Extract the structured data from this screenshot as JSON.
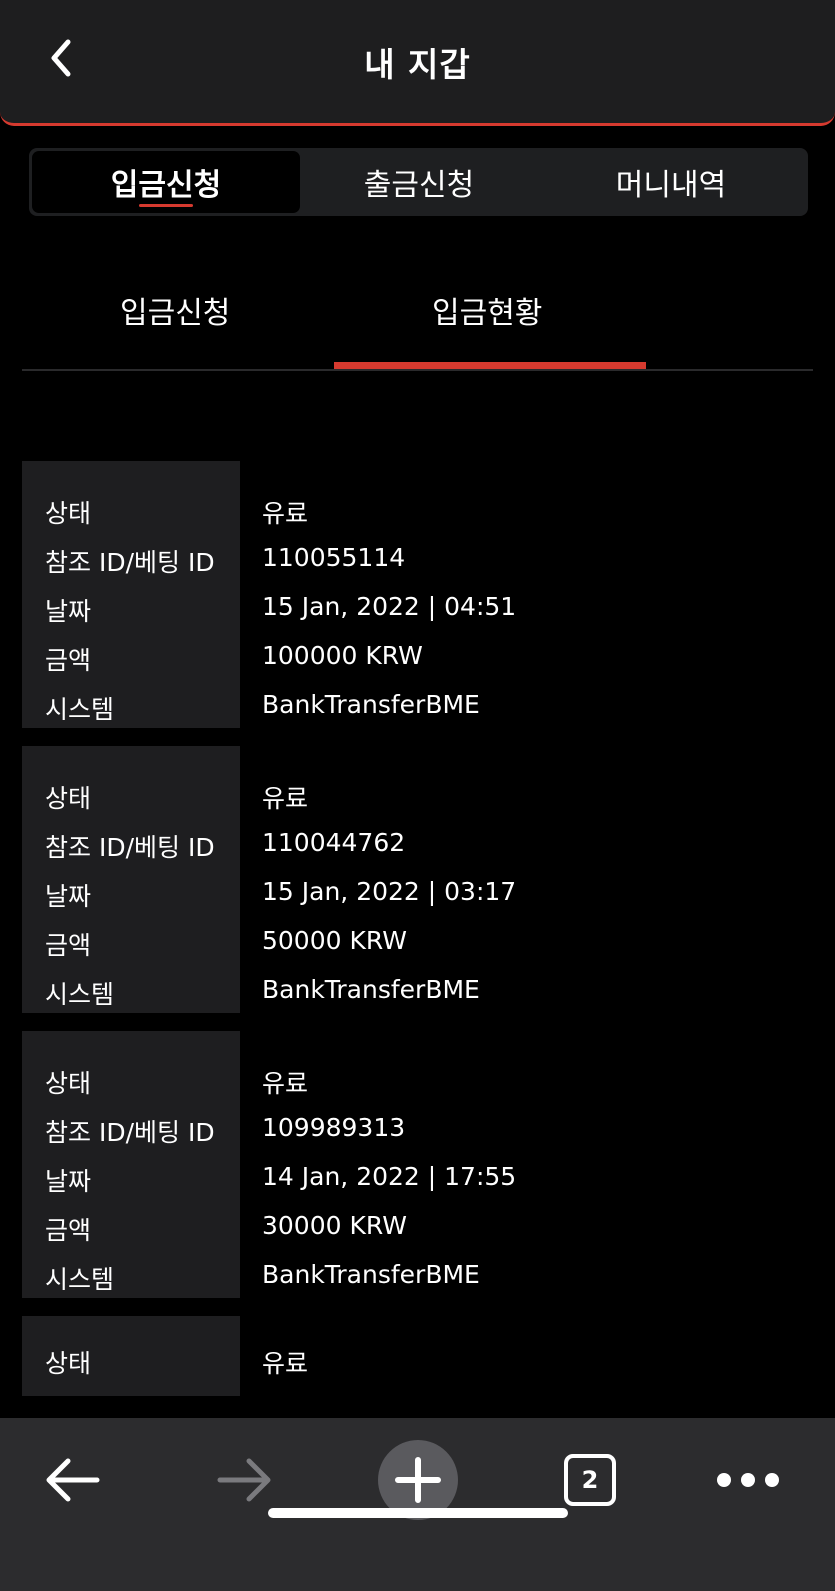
{
  "header": {
    "title": "내 지갑",
    "back_icon": "chevron-left-icon"
  },
  "segments": [
    {
      "label": "입금신청",
      "active": true
    },
    {
      "label": "출금신청",
      "active": false
    },
    {
      "label": "머니내역",
      "active": false
    }
  ],
  "subtabs": [
    {
      "label": "입금신청",
      "active": false
    },
    {
      "label": "입금현황",
      "active": true
    }
  ],
  "field_labels": {
    "status": "상태",
    "ref_id": "참조 ID/베팅 ID",
    "date": "날짜",
    "amount": "금액",
    "system": "시스템"
  },
  "records": [
    {
      "status": "유료",
      "ref_id": "110055114",
      "date": "15 Jan, 2022 | 04:51",
      "amount": "100000 KRW",
      "system": "BankTransferBME"
    },
    {
      "status": "유료",
      "ref_id": "110044762",
      "date": "15 Jan, 2022 | 03:17",
      "amount": "50000 KRW",
      "system": "BankTransferBME"
    },
    {
      "status": "유료",
      "ref_id": "109989313",
      "date": "14 Jan, 2022 | 17:55",
      "amount": "30000 KRW",
      "system": "BankTransferBME"
    },
    {
      "status": "유료"
    }
  ],
  "browser_bar": {
    "tab_count": "2",
    "icons": [
      "back-arrow-icon",
      "forward-arrow-icon",
      "plus-icon",
      "tabs-icon",
      "more-icon"
    ]
  },
  "colors": {
    "accent": "#d63a2f",
    "card_label_bg": "#1e1e20",
    "header_bg": "#1e1e1f"
  }
}
